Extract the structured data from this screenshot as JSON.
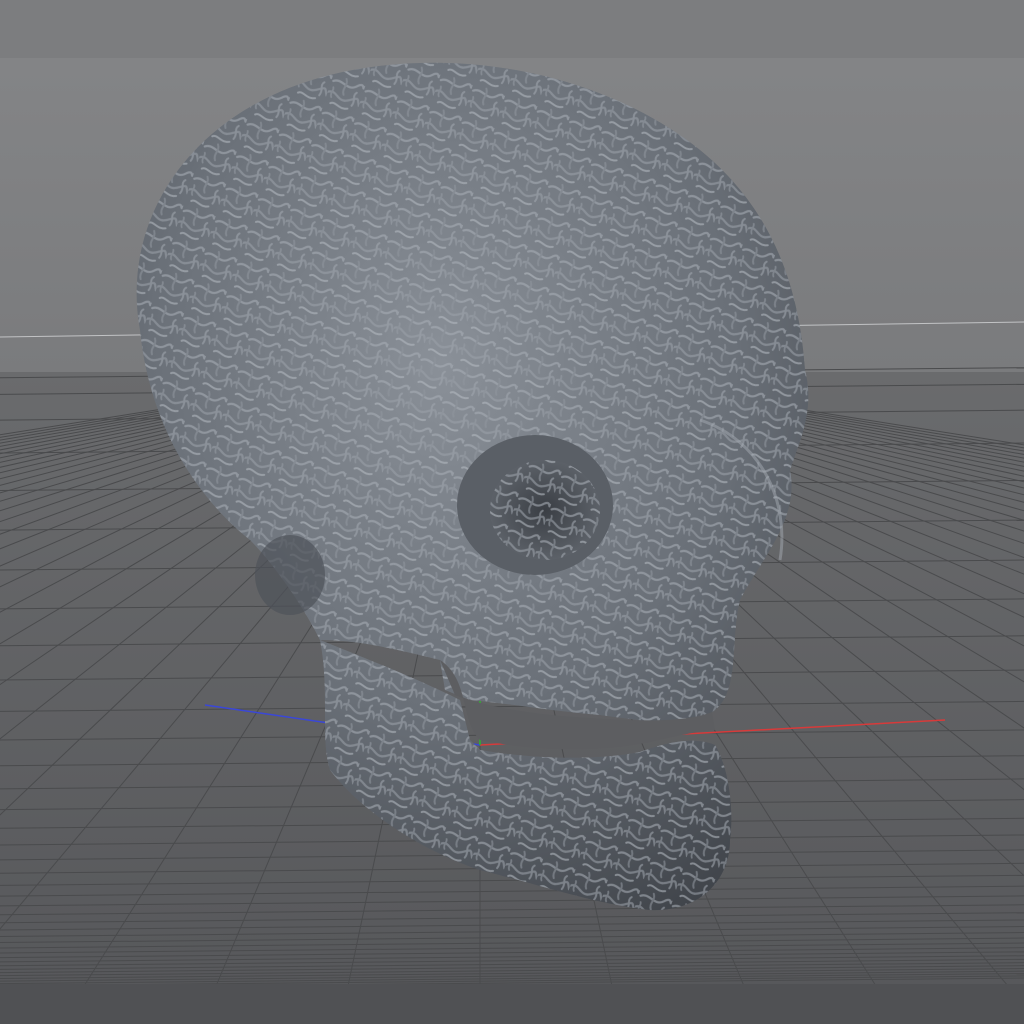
{
  "viewport": {
    "kind": "3d-perspective-view",
    "background_color": "#808080",
    "sky_color": "#7f8082",
    "ground_color": "#5f6062",
    "grid_color": "#4a4b4d",
    "horizon_line_color": "#b8b9bb",
    "object": {
      "name": "skull",
      "material_color": "#6d727a",
      "pattern": "reaction-diffusion-labyrinth"
    },
    "axes": {
      "x_color": "#d83a3a",
      "y_color": "#2fb52f",
      "z_color": "#3a47d8"
    }
  }
}
